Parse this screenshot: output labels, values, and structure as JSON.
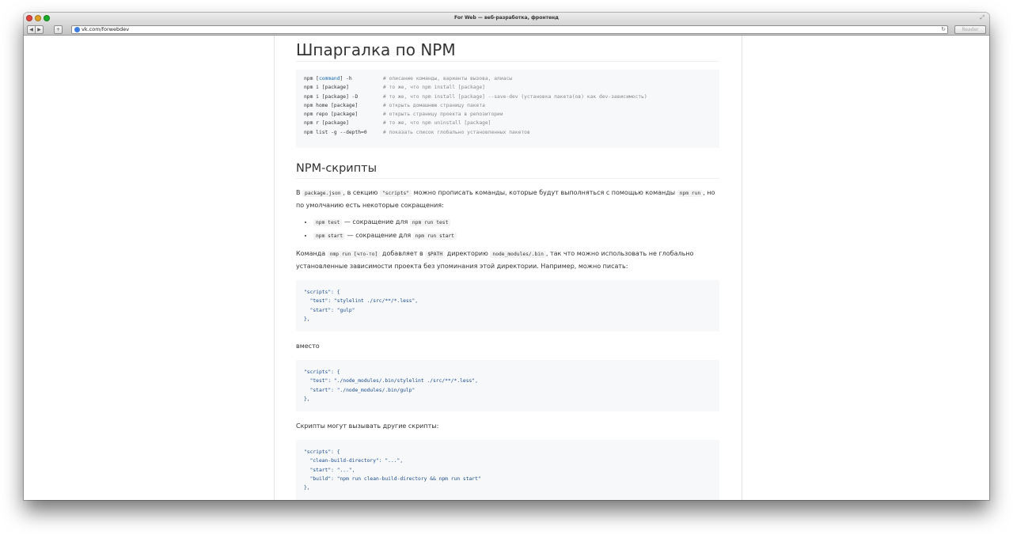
{
  "window": {
    "title": "For Web — веб-разработка, фронтенд"
  },
  "toolbar": {
    "back_label": "◀",
    "forward_label": "▶",
    "add_label": "+",
    "url": "vk.com/forwebdev",
    "reader_label": "Reader"
  },
  "article": {
    "title": "Шпаргалка по NPM",
    "cheatsheet": [
      {
        "cmd_prefix": "npm [",
        "cmd_kw": "command",
        "cmd_suffix": "] -h",
        "comment": "# описание команды, варианты вызова, алиасы"
      },
      {
        "cmd_prefix": "npm i [package]",
        "cmd_kw": "",
        "cmd_suffix": "",
        "comment": "# то же, что npm install [package]"
      },
      {
        "cmd_prefix": "npm i [package] -D",
        "cmd_kw": "",
        "cmd_suffix": "",
        "comment": "# то же, что npm install [package] --save-dev (установка пакета(ов) как dev-зависимость)"
      },
      {
        "cmd_prefix": "npm home [package]",
        "cmd_kw": "",
        "cmd_suffix": "",
        "comment": "# открыть домашнюю страницу пакета"
      },
      {
        "cmd_prefix": "npm repo [package]",
        "cmd_kw": "",
        "cmd_suffix": "",
        "comment": "# открыть страницу проекта в репозитории"
      },
      {
        "cmd_prefix": "npm r [package]",
        "cmd_kw": "",
        "cmd_suffix": "",
        "comment": "# то же, что npm uninstall [package]"
      },
      {
        "cmd_prefix": "npm list -g --depth=0",
        "cmd_kw": "",
        "cmd_suffix": "",
        "comment": "# показать список глобально установленных пакетов"
      }
    ],
    "section_title": "NPM-скрипты",
    "intro": {
      "t1": "В ",
      "c1": "package.json",
      "t2": ", в секцию ",
      "c2": "\"scripts\"",
      "t3": " можно прописать команды, которые будут выполняться с помощью команды ",
      "c3": "npm run",
      "t4": ", но по умолчанию есть некоторые сокращения:"
    },
    "bullets": [
      {
        "code1": "npm test",
        "text": " — сокращение для ",
        "code2": "npm run test"
      },
      {
        "code1": "npm start",
        "text": " — сокращение для ",
        "code2": "npm run start"
      }
    ],
    "para2": {
      "t1": "Команда ",
      "c1": "nmp run [что-то]",
      "t2": " добавляет в ",
      "c2": "$PATH",
      "t3": " директорию ",
      "c3": "node_modules/.bin",
      "t4": ", так что можно использовать не глобально установленные зависимости проекта без упоминания этой директории. Например, можно писать:"
    },
    "code1": [
      "\"scripts\": {",
      "  \"test\": \"stylelint ./src/**/*.less\",",
      "  \"start\": \"gulp\"",
      "},"
    ],
    "instead": "вместо",
    "code2": [
      "\"scripts\": {",
      "  \"test\": \"./node_modules/.bin/stylelint ./src/**/*.less\",",
      "  \"start\": \"./node_modules/.bin/gulp\"",
      "},"
    ],
    "para3": "Скрипты могут вызывать другие скрипты:",
    "code3": [
      "\"scripts\": {",
      "  \"clean-build-directory\": \"...\",",
      "  \"start\": \"...\",",
      "  \"build\": \"npm run clean-build-directory && npm run start\"",
      "},"
    ]
  }
}
